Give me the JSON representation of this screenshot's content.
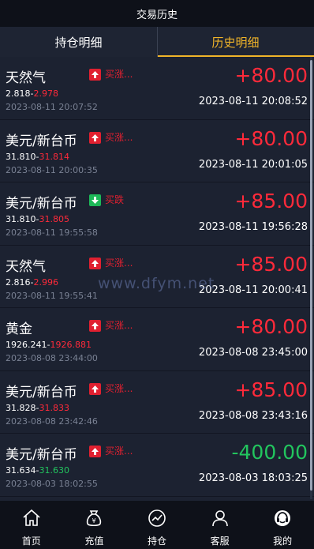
{
  "header": {
    "title": "交易历史"
  },
  "tabs": [
    {
      "label": "持仓明细",
      "active": false
    },
    {
      "label": "历史明细",
      "active": true
    }
  ],
  "trades": [
    {
      "name": "天然气",
      "direction": "买涨...",
      "open_price": "2.818",
      "close_price": "2.978",
      "open_time": "2023-08-11 20:07:52",
      "profit": "+80.00",
      "close_time": "2023-08-11 20:08:52",
      "up": true,
      "profit_positive": true,
      "close_green": false
    },
    {
      "name": "美元/新台币",
      "direction": "买涨...",
      "open_price": "31.810",
      "close_price": "31.814",
      "open_time": "2023-08-11 20:00:35",
      "profit": "+80.00",
      "close_time": "2023-08-11 20:01:05",
      "up": true,
      "profit_positive": true,
      "close_green": false
    },
    {
      "name": "美元/新台币",
      "direction": "买跌",
      "open_price": "31.810",
      "close_price": "31.805",
      "open_time": "2023-08-11 19:55:58",
      "profit": "+85.00",
      "close_time": "2023-08-11 19:56:28",
      "up": false,
      "profit_positive": true,
      "close_green": false
    },
    {
      "name": "天然气",
      "direction": "买涨...",
      "open_price": "2.816",
      "close_price": "2.996",
      "open_time": "2023-08-11 19:55:41",
      "profit": "+85.00",
      "close_time": "2023-08-11 20:00:41",
      "up": true,
      "profit_positive": true,
      "close_green": false
    },
    {
      "name": "黄金",
      "direction": "买涨...",
      "open_price": "1926.241",
      "close_price": "1926.881",
      "open_time": "2023-08-08 23:44:00",
      "profit": "+80.00",
      "close_time": "2023-08-08 23:45:00",
      "up": true,
      "profit_positive": true,
      "close_green": false
    },
    {
      "name": "美元/新台币",
      "direction": "买涨...",
      "open_price": "31.828",
      "close_price": "31.833",
      "open_time": "2023-08-08 23:42:46",
      "profit": "+85.00",
      "close_time": "2023-08-08 23:43:16",
      "up": true,
      "profit_positive": true,
      "close_green": false
    },
    {
      "name": "美元/新台币",
      "direction": "买涨...",
      "open_price": "31.634",
      "close_price": "31.630",
      "open_time": "2023-08-03 18:02:55",
      "profit": "-400.00",
      "close_time": "2023-08-03 18:03:25",
      "up": true,
      "profit_positive": false,
      "close_green": true
    }
  ],
  "watermark": "www.dfym.net",
  "nav": [
    {
      "label": "首页",
      "icon": "home-icon"
    },
    {
      "label": "充值",
      "icon": "money-bag-icon"
    },
    {
      "label": "持仓",
      "icon": "chart-icon"
    },
    {
      "label": "客服",
      "icon": "user-icon"
    },
    {
      "label": "我的",
      "icon": "headset-icon"
    }
  ],
  "colors": {
    "accent": "#f0b429",
    "up_red": "#ff2a3a",
    "down_green": "#22c55e",
    "background": "#1c2231",
    "bar": "#0e1119"
  }
}
